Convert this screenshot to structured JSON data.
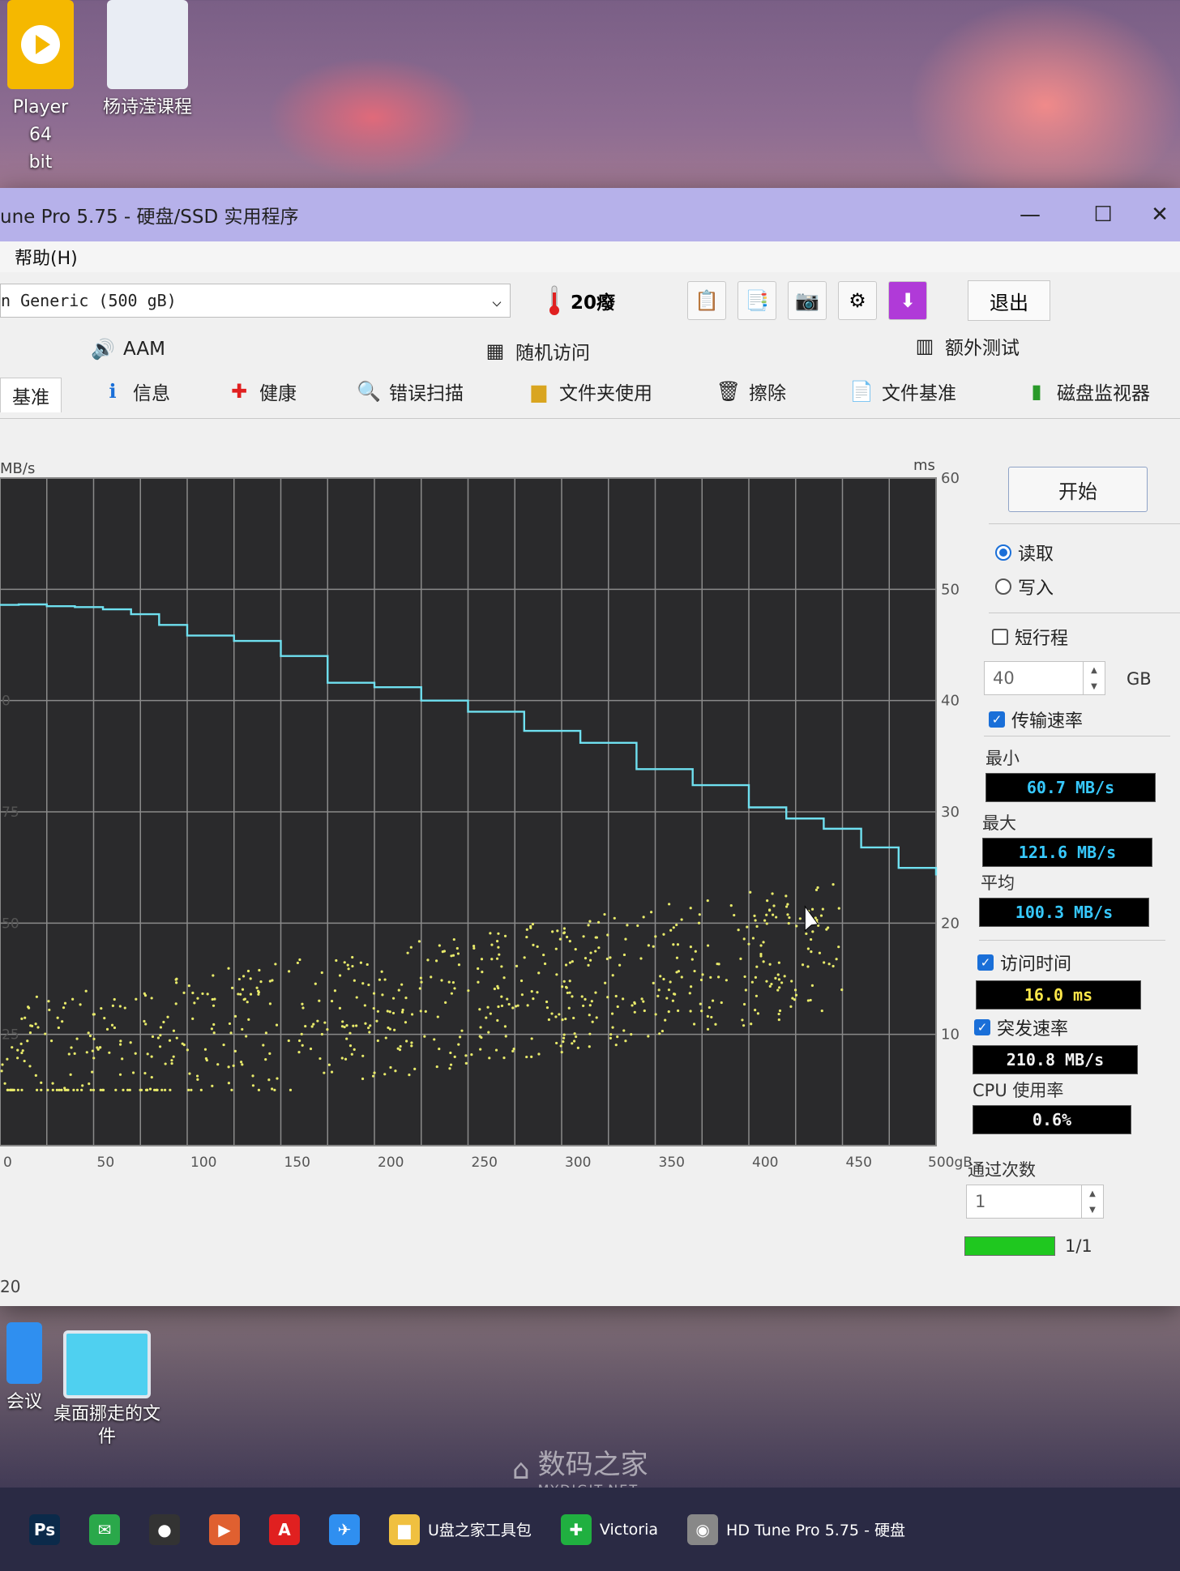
{
  "desktop": {
    "icons_top": [
      {
        "label": "Player 64\nbit",
        "color": "#f5b800"
      },
      {
        "label": "杨诗滢课程",
        "color": "#e9edf4"
      }
    ],
    "icons_bottom": [
      {
        "label": "会议",
        "color": "#2f8ff0"
      },
      {
        "label": "桌面挪走的文\n件",
        "color": "#4fd0f0"
      }
    ],
    "watermark_main": "数码之家",
    "watermark_sub": "MYDIGIT.NET"
  },
  "window": {
    "title": "une Pro 5.75 - 硬盘/SSD 实用程序",
    "minimize": "—",
    "maximize": "☐",
    "close": "✕"
  },
  "menu": {
    "help": "帮助(H)"
  },
  "toolbar": {
    "drive": "n Generic (500 gB)",
    "dropdown_arrow": "⌵",
    "temperature": "20癈",
    "exit": "退出",
    "buttons": [
      "copy-icon",
      "copy-all-icon",
      "camera-icon",
      "settings-icon",
      "download-icon"
    ]
  },
  "tabs": {
    "row1": [
      "AAM",
      "随机访问",
      "额外测试"
    ],
    "row2": [
      "基准",
      "信息",
      "健康",
      "错误扫描",
      "文件夹使用",
      "擦除",
      "文件基准",
      "磁盘监视器"
    ]
  },
  "chart": {
    "unit_left": "MB/s",
    "unit_right": "ms"
  },
  "chart_data": {
    "type": "line",
    "x_label_unit": "gB",
    "x_ticks": [
      "0",
      "50",
      "100",
      "150",
      "200",
      "250",
      "300",
      "350",
      "400",
      "450",
      "500gB"
    ],
    "y_left_ticks": [
      "25",
      "50",
      "75",
      "0"
    ],
    "y_right_ticks": [
      "10",
      "20",
      "30",
      "40",
      "50",
      "60"
    ],
    "xlim": [
      0,
      500
    ],
    "ylim_left": [
      0,
      150
    ],
    "ylim_right": [
      0,
      60
    ],
    "grid": true,
    "series": [
      {
        "kind": "transfer-rate-line",
        "axis": "left",
        "color": "#6fe0f0",
        "x": [
          0,
          10,
          25,
          40,
          55,
          70,
          85,
          100,
          125,
          150,
          175,
          200,
          225,
          250,
          280,
          310,
          340,
          370,
          400,
          420,
          440,
          460,
          480,
          500
        ],
        "y": [
          121.5,
          121.6,
          121.2,
          121.0,
          120.5,
          119.4,
          117.0,
          114.6,
          113.4,
          110.0,
          104.0,
          103.0,
          100.0,
          97.5,
          93.2,
          90.5,
          84.6,
          81.0,
          76.0,
          73.5,
          71.2,
          67.0,
          62.4,
          60.7
        ]
      },
      {
        "kind": "access-time-scatter",
        "axis": "right",
        "color": "#e8ea6a",
        "x_range": [
          0,
          450
        ],
        "y_range_ms": [
          5,
          28
        ]
      }
    ]
  },
  "panel": {
    "start": "开始",
    "read": "读取",
    "write": "写入",
    "short_stroke": "短行程",
    "short_stroke_value": "40",
    "gb": "GB",
    "transfer_rate": "传输速率",
    "min_label": "最小",
    "min_value": "60.7 MB/s",
    "max_label": "最大",
    "max_value": "121.6 MB/s",
    "avg_label": "平均",
    "avg_value": "100.3 MB/s",
    "access_time": "访问时间",
    "access_value": "16.0 ms",
    "burst_rate": "突发速率",
    "burst_value": "210.8 MB/s",
    "cpu_label": "CPU 使用率",
    "cpu_value": "0.6%",
    "passes_label": "通过次数",
    "passes_value": "1",
    "progress_text": "1/1",
    "progress": 1.0
  },
  "taskbar": {
    "items": [
      {
        "icon": "photoshop-icon",
        "glyph": "Ps",
        "label": "",
        "color": "#0b2a4a"
      },
      {
        "icon": "wechat-icon",
        "glyph": "✉",
        "label": "",
        "color": "#2aa84a"
      },
      {
        "icon": "qq-icon",
        "glyph": "●",
        "label": "",
        "color": "#333"
      },
      {
        "icon": "media-icon",
        "glyph": "▶",
        "label": "",
        "color": "#e06030"
      },
      {
        "icon": "acrobat-icon",
        "glyph": "A",
        "label": "",
        "color": "#e02020"
      },
      {
        "icon": "mail-icon",
        "glyph": "✈",
        "label": "",
        "color": "#2f8ff0"
      },
      {
        "icon": "folder-icon",
        "glyph": "▆",
        "label": "U盘之家工具包",
        "color": "#f0c040"
      },
      {
        "icon": "victoria-icon",
        "glyph": "✚",
        "label": "Victoria",
        "color": "#20b040"
      },
      {
        "icon": "hdtune-icon",
        "glyph": "◉",
        "label": "HD Tune Pro 5.75 - 硬盘",
        "color": "#888"
      }
    ]
  },
  "left_edge": {
    "label_20": "20"
  }
}
